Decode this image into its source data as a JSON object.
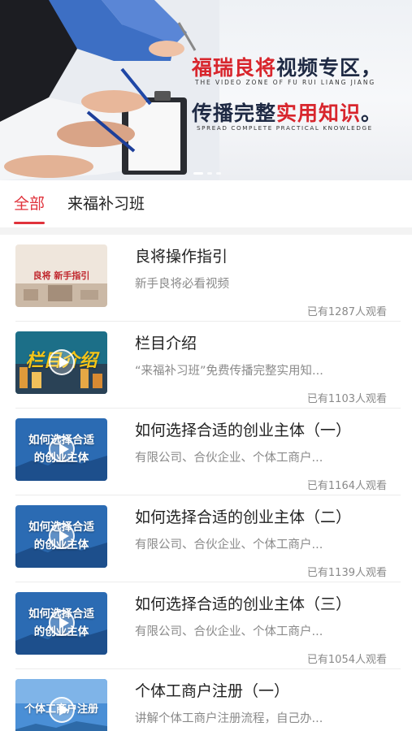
{
  "banner": {
    "line1_red": "福瑞良将",
    "line1_dark": "视频专区，",
    "line1_en": "THE VIDEO ZONE OF FU RUI LIANG JIANG",
    "line2_dark": "传播完整",
    "line2_red": "实用知识",
    "line2_end": "。",
    "line2_en": "SPREAD COMPLETE PRACTICAL KNOWLEDGE",
    "slide_count": 3,
    "active_slide": 1
  },
  "tabs": [
    {
      "label": "全部",
      "active": true
    },
    {
      "label": "来福补习班",
      "active": false
    }
  ],
  "videos": [
    {
      "title": "良将操作指引",
      "desc": "新手良将必看视频",
      "views": "已有1287人观看",
      "thumb_text": "良将  新手指引",
      "thumb_style": "light"
    },
    {
      "title": "栏目介绍",
      "desc": "“来福补习班”免费传播完整实用知...",
      "views": "已有1103人观看",
      "thumb_text": "栏目介绍",
      "thumb_style": "city"
    },
    {
      "title": "如何选择合适的创业主体（一）",
      "desc": "有限公司、合伙企业、个体工商户...",
      "views": "已有1164人观看",
      "thumb_text": "如何选择合适\n的创业主体",
      "thumb_style": "blue"
    },
    {
      "title": "如何选择合适的创业主体（二）",
      "desc": "有限公司、合伙企业、个体工商户...",
      "views": "已有1139人观看",
      "thumb_text": "如何选择合适\n的创业主体",
      "thumb_style": "blue"
    },
    {
      "title": "如何选择合适的创业主体（三）",
      "desc": "有限公司、合伙企业、个体工商户...",
      "views": "已有1054人观看",
      "thumb_text": "如何选择合适\n的创业主体",
      "thumb_style": "blue"
    },
    {
      "title": "个体工商户注册（一）",
      "desc": "讲解个体工商户注册流程，自己办...",
      "views": "",
      "thumb_text": "个体工商户注册",
      "thumb_style": "sky"
    }
  ],
  "colors": {
    "accent": "#e0323b",
    "banner_red": "#d8262d",
    "banner_dark": "#1f2a44"
  }
}
